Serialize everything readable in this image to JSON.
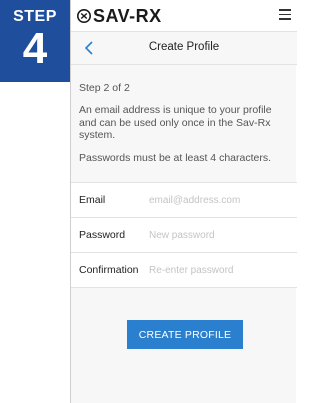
{
  "step_badge": {
    "word": "STEP",
    "number": "4"
  },
  "app": {
    "brand": "SAV-RX",
    "menu_icon": "hamburger-menu-icon",
    "logo_icon": "savrx-logo-mark"
  },
  "nav": {
    "back_icon": "chevron-left-icon",
    "title": "Create Profile"
  },
  "content": {
    "step_label": "Step 2 of 2",
    "info": "An email address is unique to your profile and can be used only once in the Sav-Rx system.",
    "password_note": "Passwords must be at least 4 characters."
  },
  "form": {
    "email": {
      "label": "Email",
      "placeholder": "email@address.com",
      "value": ""
    },
    "password": {
      "label": "Password",
      "placeholder": "New password",
      "value": ""
    },
    "confirmation": {
      "label": "Confirmation",
      "placeholder": "Re-enter password",
      "value": ""
    }
  },
  "actions": {
    "create_label": "CREATE PROFILE"
  },
  "colors": {
    "badge": "#1f4e9c",
    "button": "#2a7fce",
    "background": "#f7f7f7"
  }
}
